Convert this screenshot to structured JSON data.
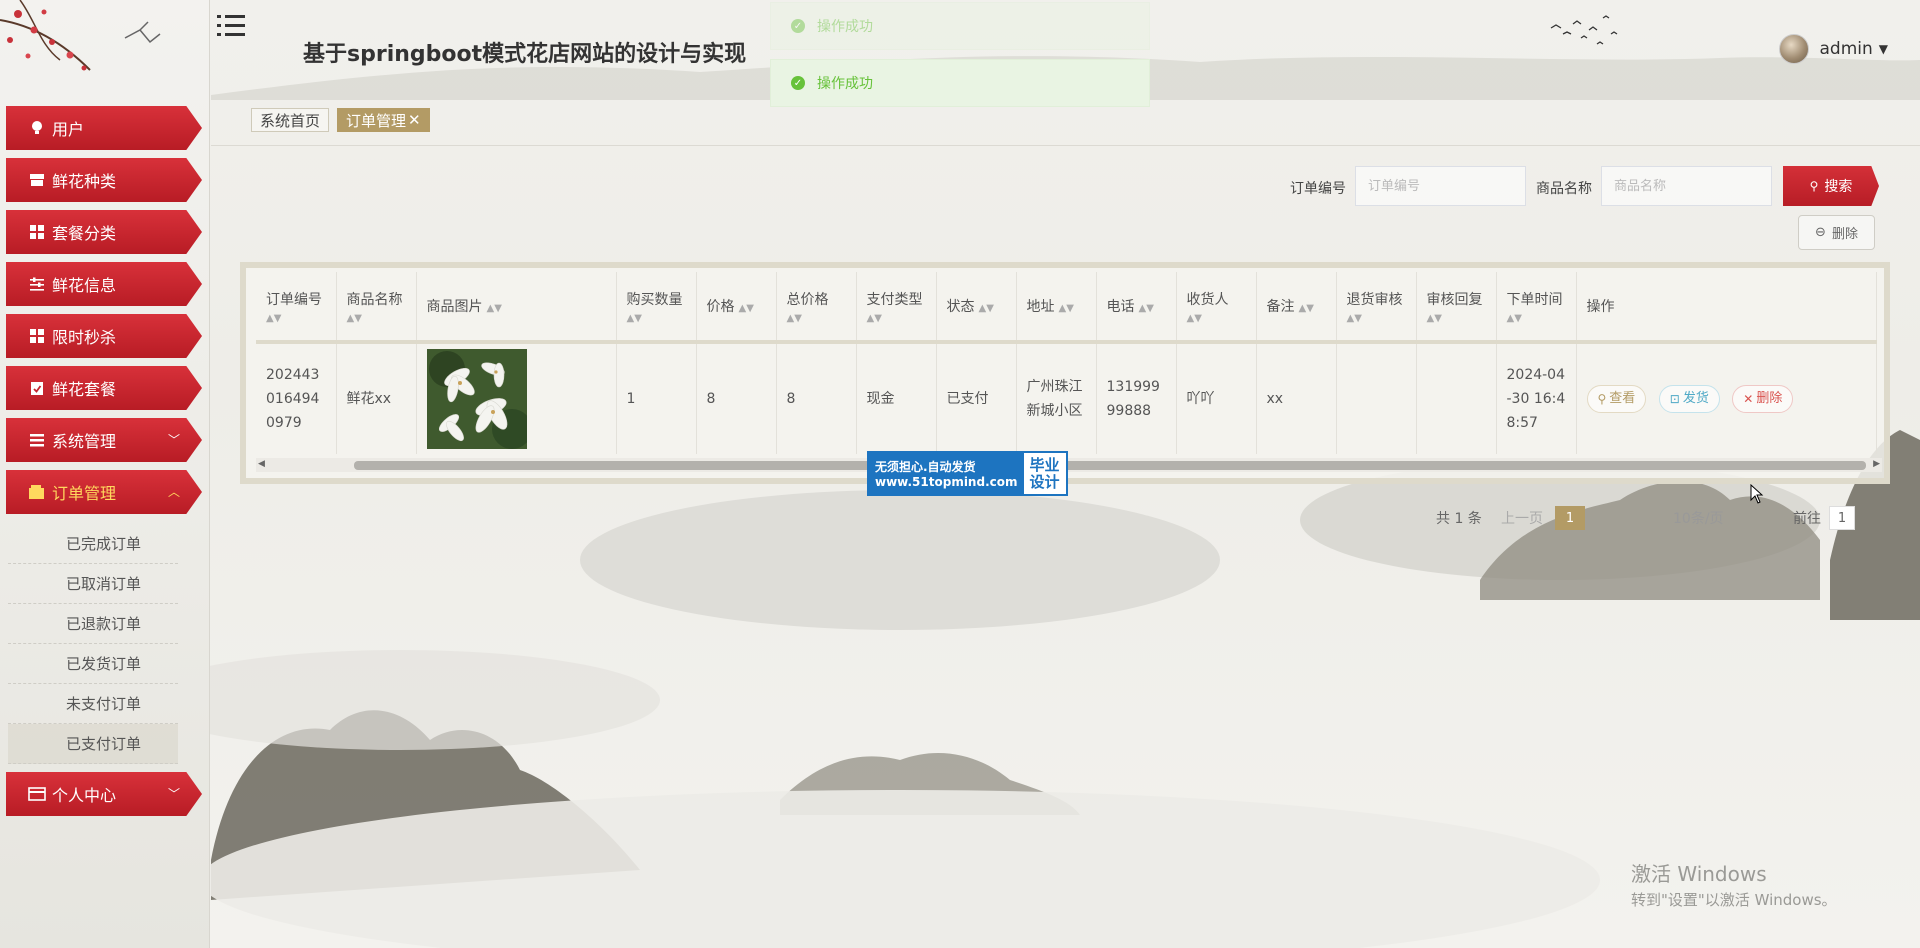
{
  "app": {
    "title": "基于springboot模式花店网站的设计与实现",
    "username": "admin"
  },
  "colors": {
    "accent_red": "#c32630",
    "active_tab": "#b39b65",
    "success_green": "#67c23a",
    "active_menu_text": "#ffd85e"
  },
  "sidebar": {
    "items": [
      {
        "label": "用户",
        "icon": "lightbulb-icon"
      },
      {
        "label": "鲜花种类",
        "icon": "store-icon"
      },
      {
        "label": "套餐分类",
        "icon": "grid-icon"
      },
      {
        "label": "鲜花信息",
        "icon": "sliders-icon"
      },
      {
        "label": "限时秒杀",
        "icon": "grid-icon"
      },
      {
        "label": "鲜花套餐",
        "icon": "clipboard-check-icon"
      },
      {
        "label": "系统管理",
        "icon": "list-icon"
      },
      {
        "label": "订单管理",
        "icon": "wallet-icon"
      },
      {
        "label": "个人中心",
        "icon": "card-icon"
      }
    ],
    "submenu": [
      {
        "label": "已完成订单"
      },
      {
        "label": "已取消订单"
      },
      {
        "label": "已退款订单"
      },
      {
        "label": "已发货订单"
      },
      {
        "label": "未支付订单"
      },
      {
        "label": "已支付订单"
      }
    ]
  },
  "toasts": [
    {
      "text": "操作成功"
    },
    {
      "text": "操作成功"
    }
  ],
  "tabs": {
    "home": "系统首页",
    "active": "订单管理",
    "close": "✕"
  },
  "search": {
    "order_no_label": "订单编号",
    "order_no_placeholder": "订单编号",
    "product_label": "商品名称",
    "product_placeholder": "商品名称",
    "search_button": "搜索",
    "delete_button": "删除"
  },
  "table": {
    "columns": [
      "订单编号",
      "商品名称",
      "商品图片",
      "购买数量",
      "价格",
      "总价格",
      "支付类型",
      "状态",
      "地址",
      "电话",
      "收货人",
      "备注",
      "退货审核",
      "审核回复",
      "下单时间",
      "操作"
    ],
    "row": {
      "order_no": "2024430164940979",
      "product": "鲜花xx",
      "quantity": "1",
      "price": "8",
      "total": "8",
      "pay_type": "现金",
      "status": "已支付",
      "address": "广州珠江新城小区",
      "phone": "13199999888",
      "receiver": "吖吖",
      "remark": "xx",
      "return_review": "",
      "review_reply": "",
      "order_time": "2024-04-30 16:48:57"
    },
    "actions": {
      "view": "查看",
      "ship": "发货",
      "delete": "删除"
    }
  },
  "watermark": {
    "line1": "无须担心.自动发货",
    "line2": "www.51topmind.com",
    "side1": "毕业",
    "side2": "设计"
  },
  "pagination": {
    "total": "共 1 条",
    "prev": "上一页",
    "current": "1",
    "page_size": "10条/页",
    "goto": "前往",
    "goto_value": "1"
  },
  "windows": {
    "line1": "激活 Windows",
    "line2": "转到\"设置\"以激活 Windows。"
  }
}
